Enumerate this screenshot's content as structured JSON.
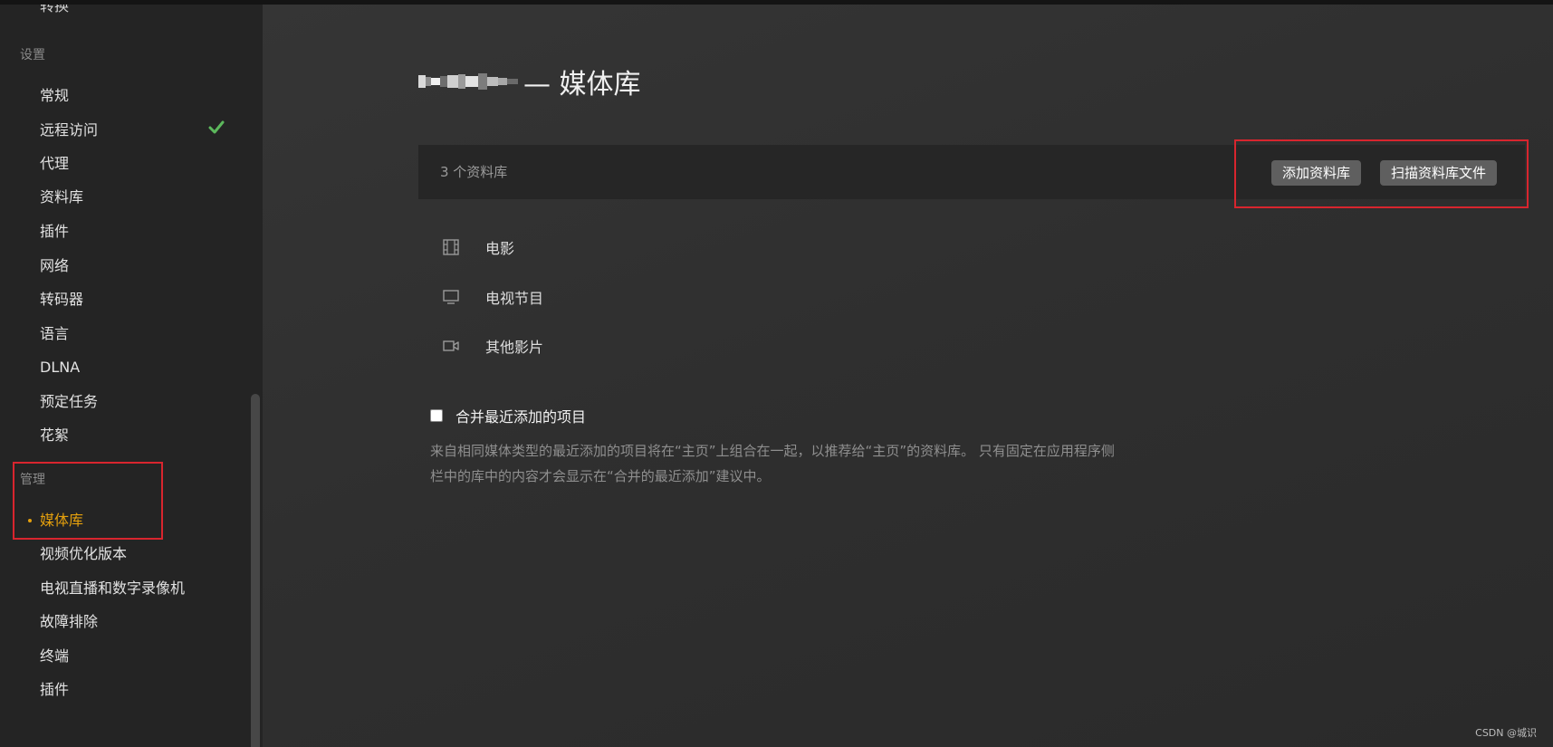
{
  "sidebar": {
    "clipped_item": "转换",
    "settings_header": "设置",
    "settings_items": [
      "常规",
      "远程访问",
      "代理",
      "资料库",
      "插件",
      "网络",
      "转码器",
      "语言",
      "DLNA",
      "预定任务",
      "花絮"
    ],
    "manage_header": "管理",
    "manage_items": [
      "媒体库",
      "视频优化版本",
      "电视直播和数字录像机",
      "故障排除",
      "终端",
      "插件"
    ],
    "active_item": "媒体库",
    "accent_color": "#e5a00d",
    "check_color": "#5cb85c"
  },
  "main": {
    "title_suffix": "— 媒体库",
    "library_count": "3 个资料库",
    "add_library_label": "添加资料库",
    "scan_library_label": "扫描资料库文件",
    "libraries": [
      {
        "icon": "film-icon",
        "name": "电影"
      },
      {
        "icon": "tv-icon",
        "name": "电视节目"
      },
      {
        "icon": "video-camera-icon",
        "name": "其他影片"
      }
    ],
    "merge_label": "合并最近添加的项目",
    "merge_description": "来自相同媒体类型的最近添加的项目将在“主页”上组合在一起，以推荐给“主页”的资料库。 只有固定在应用程序侧栏中的库中的内容才会显示在“合并的最近添加”建议中。",
    "merge_checked": false
  },
  "watermark": "CSDN @城识",
  "highlight_color": "#d8252e"
}
